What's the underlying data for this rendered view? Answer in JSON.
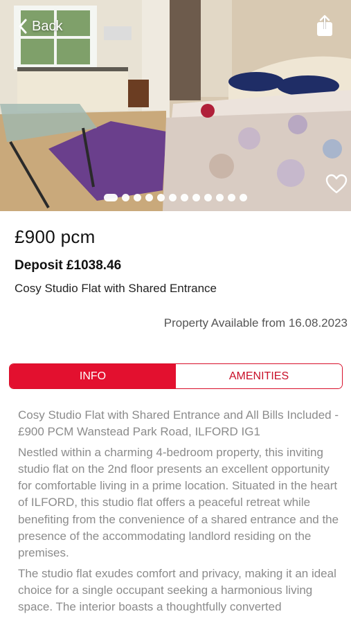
{
  "header": {
    "back_label": "Back",
    "share_icon": "share-icon",
    "favorite_icon": "heart-icon"
  },
  "gallery": {
    "total_images": 12,
    "active_index": 0
  },
  "listing": {
    "price": "£900 pcm",
    "deposit": "Deposit £1038.46",
    "title": "Cosy Studio Flat with Shared Entrance",
    "availability": "Property Available from 16.08.2023"
  },
  "tabs": [
    {
      "label": "INFO",
      "active": true
    },
    {
      "label": "AMENITIES",
      "active": false
    }
  ],
  "description": {
    "paragraph_1": "Cosy Studio Flat with Shared Entrance and All Bills Included - £900 PCM  Wanstead Park Road, ILFORD IG1",
    "paragraph_2": "Nestled within a charming 4-bedroom property, this inviting studio flat on the 2nd floor presents an excellent opportunity for comfortable living in a prime location. Situated in the heart of ILFORD, this studio flat offers a peaceful retreat while benefiting from the convenience of a shared entrance and the presence of the accommodating landlord residing on the premises.",
    "paragraph_3": "The studio flat exudes comfort and privacy, making it an ideal choice for a single occupant seeking a harmonious living space. The interior boasts a thoughtfully converted"
  },
  "colors": {
    "accent": "#e3102f",
    "text_muted": "#8b8b8b"
  }
}
